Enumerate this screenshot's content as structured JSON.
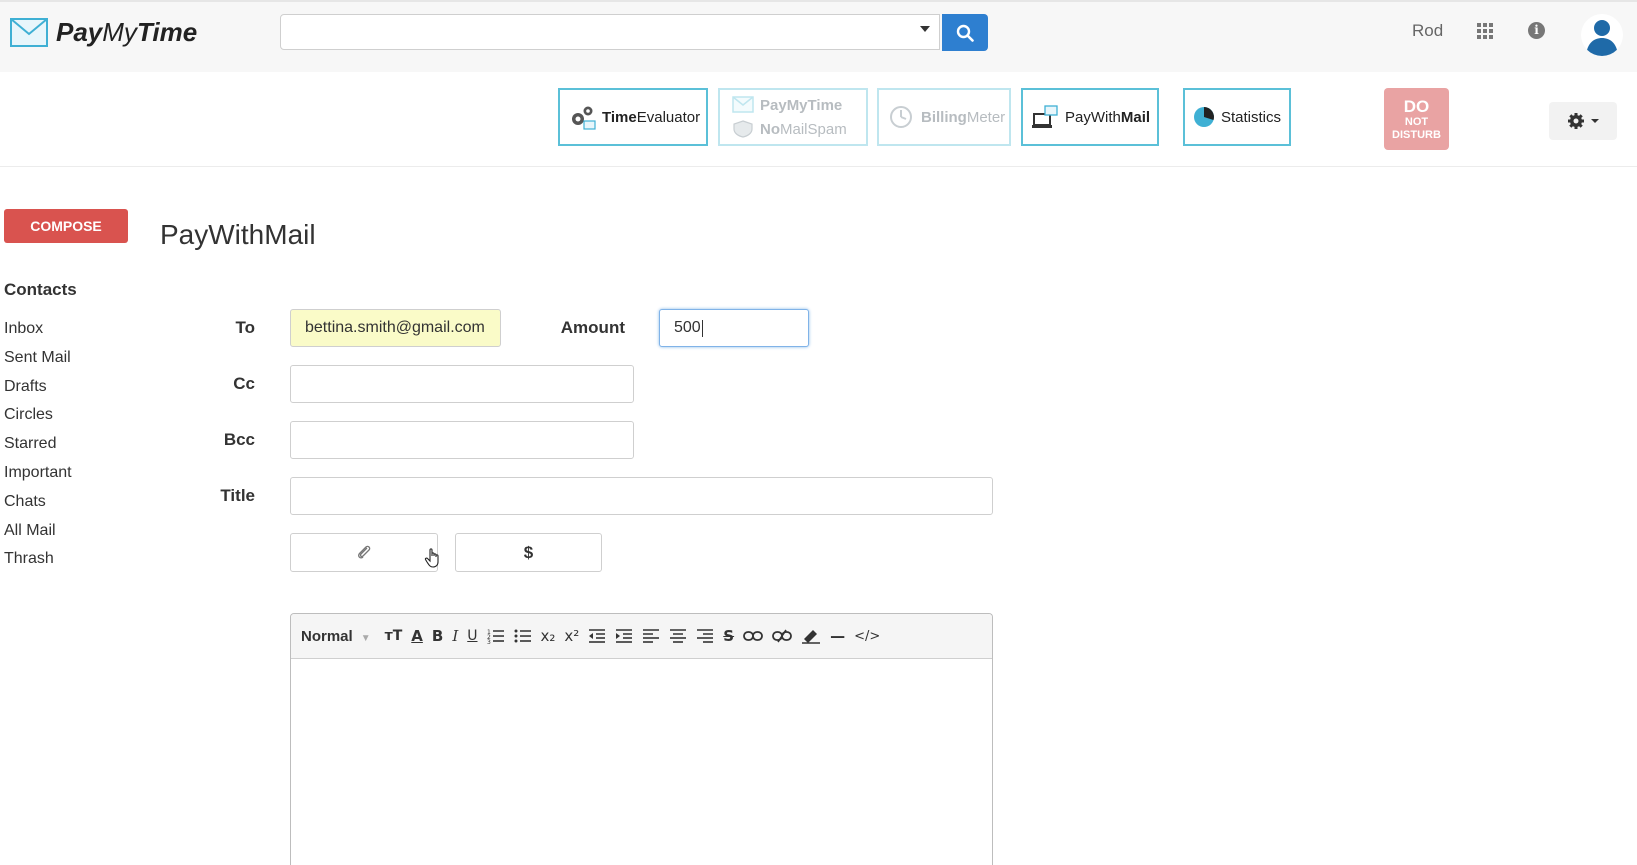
{
  "header": {
    "brand_pay": "Pay",
    "brand_my": "My",
    "brand_time": "Time",
    "search_value": "",
    "user_name": "Rod",
    "info_glyph": "i"
  },
  "apps": {
    "time_evaluator": {
      "bold": "Time",
      "rest": "Evaluator"
    },
    "paymytime": {
      "line1": "PayMyTime",
      "line2_bold": "No",
      "line2_rest": "MailSpam"
    },
    "billing_meter": {
      "bold": "Billing",
      "rest": "Meter"
    },
    "pay_with_mail": {
      "rest": "PayWith",
      "bold": "Mail"
    },
    "statistics": {
      "label": "Statistics"
    },
    "dnd": {
      "line1": "DO",
      "line2": "NOT",
      "line3": "DISTURB"
    }
  },
  "sidebar": {
    "compose_label": "COMPOSE",
    "contacts_heading": "Contacts",
    "folders": [
      "Inbox",
      "Sent Mail",
      "Drafts",
      "Circles",
      "Starred",
      "Important",
      "Chats",
      "All Mail",
      "Thrash"
    ]
  },
  "main": {
    "title": "PayWithMail",
    "to_label": "To",
    "to_value": "bettina.smith@gmail.com",
    "amount_label": "Amount",
    "amount_value": "500",
    "cc_label": "Cc",
    "cc_value": "",
    "bcc_label": "Bcc",
    "bcc_value": "",
    "title_label": "Title",
    "title_value": "",
    "dollar_label": "$"
  },
  "editor": {
    "format_value": "Normal",
    "toolbar_icons": [
      "font-size-icon",
      "font-color-icon",
      "bold-icon",
      "italic-icon",
      "underline-icon",
      "ordered-list-icon",
      "bullet-list-icon",
      "subscript-icon",
      "superscript-icon",
      "outdent-icon",
      "indent-icon",
      "align-left-icon",
      "align-center-icon",
      "align-right-icon",
      "strikethrough-icon",
      "link-icon",
      "unlink-icon",
      "highlight-icon",
      "horizontal-rule-icon",
      "code-icon"
    ],
    "bold_glyph": "B",
    "italic_glyph": "I",
    "underline_glyph": "U",
    "subscript_glyph": "x₂",
    "superscript_glyph": "x²",
    "strike_glyph": "S",
    "code_glyph": "</>",
    "hr_glyph": "—"
  },
  "colors": {
    "accent": "#2e7fd0",
    "tile_border": "#5bc0d8",
    "compose": "#d9534f",
    "dnd": "#e9a3a3",
    "to_highlight": "#fafbc8"
  }
}
